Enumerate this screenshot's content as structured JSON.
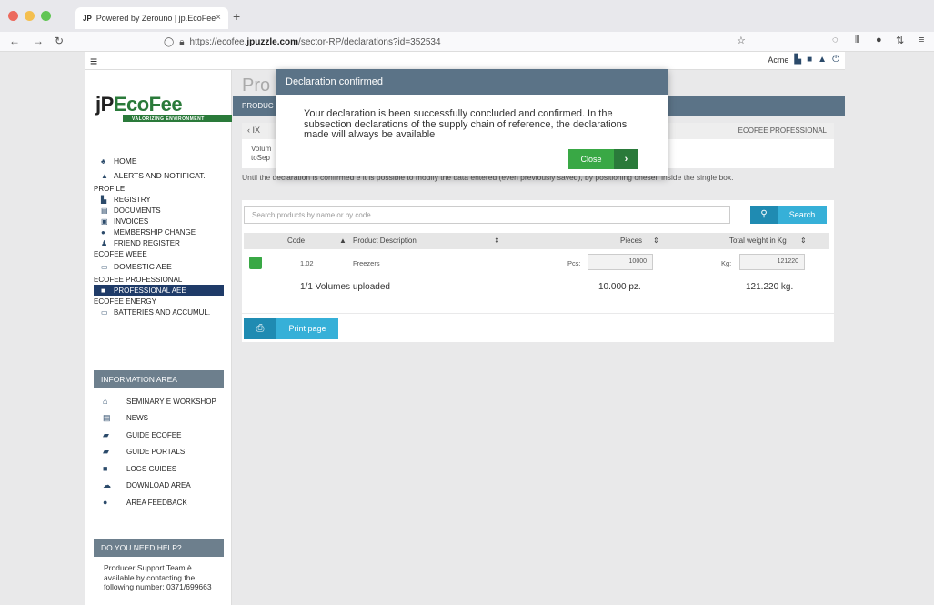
{
  "browser": {
    "tab_title": "Powered by Zerouno | jp.EcoFee",
    "tab_close": "×",
    "tab_favicon": "JP",
    "new_tab": "+",
    "url_prefix": "https://ecofee.",
    "url_domain": "jpuzzle.com",
    "url_path": "/sector-RP/declarations?id=352534"
  },
  "header": {
    "user": "Acme"
  },
  "sidebar": {
    "logo_jp": "jP",
    "logo_eco": "EcoFee",
    "logo_sub": "VALORIZING ENVIRONMENT",
    "top_items": [
      {
        "label": "HOME",
        "icon": "group-icon"
      },
      {
        "label": "ALERTS AND NOTIFICAT.",
        "icon": "bell-icon"
      }
    ],
    "sections": {
      "profile": "PROFILE",
      "weee": "ECOFEE WEEE",
      "professional": "ECOFEE PROFESSIONAL",
      "energy": "ECOFEE ENERGY"
    },
    "profile_items": [
      {
        "label": "REGISTRY"
      },
      {
        "label": "DOCUMENTS"
      },
      {
        "label": "INVOICES"
      },
      {
        "label": "MEMBERSHIP CHANGE"
      },
      {
        "label": "FRIEND REGISTER"
      }
    ],
    "weee_item": "DOMESTIC AEE",
    "professional_item": "PROFESSIONAL AEE",
    "energy_item": "BATTERIES AND ACCUMUL.",
    "info_header": "INFORMATION AREA",
    "info_items": [
      "SEMINARY E WORKSHOP",
      "NEWS",
      "GUIDE ECOFEE",
      "GUIDE PORTALS",
      "LOGS GUIDES",
      "DOWNLOAD AREA",
      "AREA FEEDBACK"
    ],
    "help_header": "DO YOU NEED HELP?",
    "help_text": "Producer Support Team è available by contacting the following number: 0371/699663"
  },
  "main": {
    "page_title": "Pro",
    "bar_label": "PRODUC",
    "crumb_left": "IX",
    "crumb_right": "ECOFEE PROFESSIONAL",
    "volume_line1": "Volum",
    "volume_line2": "toSep",
    "note": "Until the declaration is confirmed e it is possible to modify the data entered (even previously saved), by positioning oneself inside the single box.",
    "search_placeholder": "Search products by name or by code",
    "search_label": "Search",
    "columns": {
      "code": "Code",
      "description": "Product Description",
      "pieces": "Pieces",
      "weight": "Total weight in Kg"
    },
    "row": {
      "code": "1.02",
      "description": "Freezers",
      "pcs_label": "Pcs:",
      "pcs_value": "10000",
      "kg_label": "Kg:",
      "kg_value": "121220"
    },
    "summary": {
      "volumes": "1/1 Volumes uploaded",
      "pieces": "10.000 pz.",
      "weight": "121.220 kg."
    },
    "print_label": "Print page"
  },
  "modal": {
    "title": "Declaration confirmed",
    "body": "Your declaration is been successfully concluded and confirmed. In the subsection declarations of the supply chain of reference, the declarations made will always be available",
    "close_label": "Close"
  },
  "colors": {
    "header_blue": "#5b7387",
    "nav_active": "#1f3b68",
    "green": "#39a845",
    "cyan": "#36b0d8"
  }
}
